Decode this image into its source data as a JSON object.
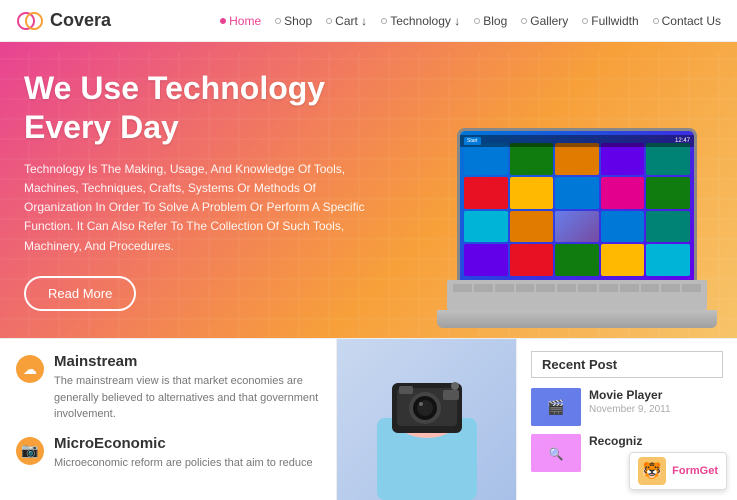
{
  "header": {
    "logo_text": "Covera",
    "nav_items": [
      {
        "label": "Home",
        "active": true
      },
      {
        "label": "Shop",
        "active": false
      },
      {
        "label": "Cart ↓",
        "active": false
      },
      {
        "label": "Technology ↓",
        "active": false
      },
      {
        "label": "Blog",
        "active": false
      },
      {
        "label": "Gallery",
        "active": false
      },
      {
        "label": "Fullwidth",
        "active": false
      },
      {
        "label": "Contact Us",
        "active": false
      }
    ]
  },
  "hero": {
    "title": "We Use Technology\nEvery Day",
    "description": "Technology Is The Making, Usage, And Knowledge Of Tools, Machines, Techniques, Crafts, Systems Or Methods Of Organization In Order To Solve A Problem Or Perform A Specific Function. It Can Also Refer To The Collection Of Such Tools, Machinery, And Procedures.",
    "button_label": "Read More"
  },
  "features": [
    {
      "icon": "☁",
      "icon_type": "cloud",
      "title": "Mainstream",
      "description": "The mainstream view is that market economies are generally believed to alternatives and that government involvement."
    },
    {
      "icon": "📷",
      "icon_type": "camera",
      "title": "MicroEconomic",
      "description": "Microeconomic reform are policies that aim to reduce"
    }
  ],
  "sidebar": {
    "recent_post_header": "Recent Post",
    "posts": [
      {
        "title": "Movie Player",
        "date": "November 9, 2011",
        "icon": "🎬"
      },
      {
        "title": "Recogniz",
        "date": "",
        "icon": "🔍"
      }
    ]
  },
  "formget": {
    "label": "FormGet"
  }
}
